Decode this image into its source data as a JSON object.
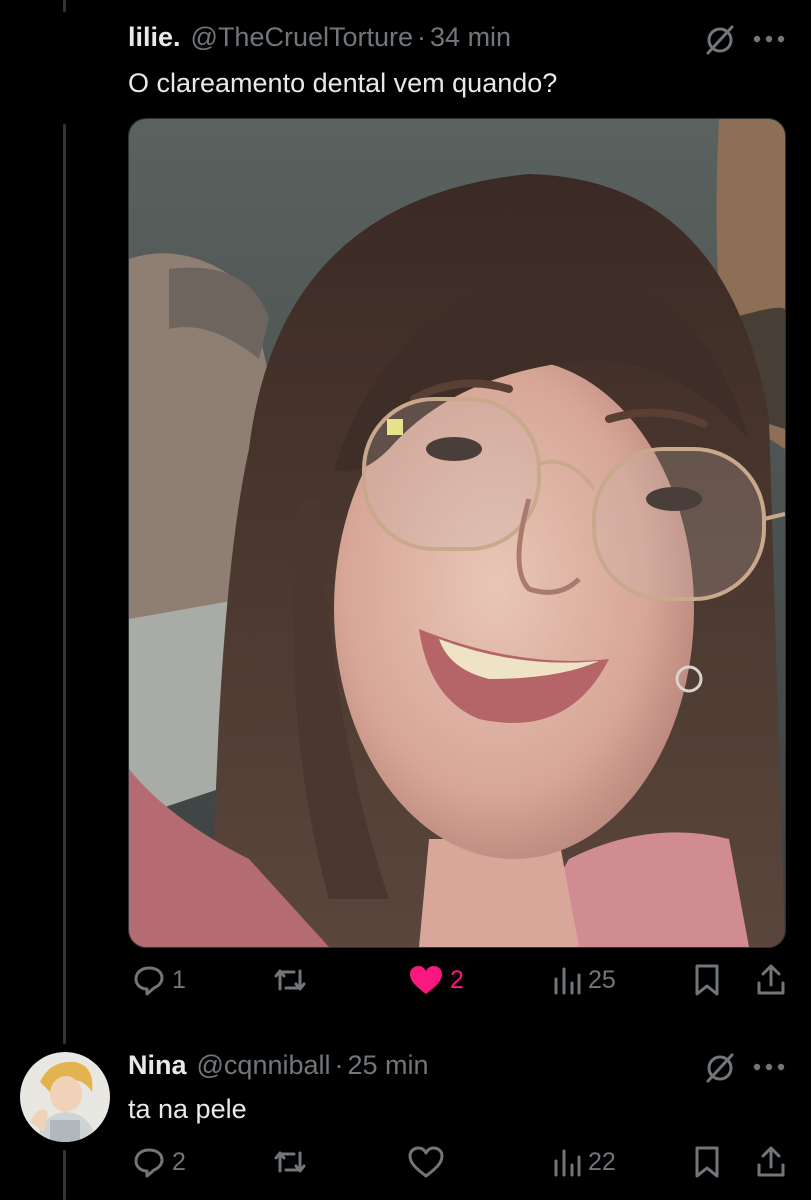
{
  "tweet1": {
    "display_name": "lilie.",
    "handle": "@TheCruelTorture",
    "separator": "·",
    "time": "34 min",
    "text": "O clareamento dental vem quando?",
    "media_icon": "selfie-photo",
    "actions": {
      "reply_count": "1",
      "retweet_count": "",
      "like_count": "2",
      "liked": true,
      "views_count": "25"
    }
  },
  "tweet2": {
    "display_name": "Nina",
    "handle": "@cqnniball",
    "separator": "·",
    "time": "25 min",
    "text": "ta na pele",
    "actions": {
      "reply_count": "2",
      "retweet_count": "",
      "like_count": "",
      "liked": false,
      "views_count": "22"
    }
  },
  "colors": {
    "background": "#000000",
    "text_primary": "#e7e9ea",
    "text_secondary": "#71767b",
    "like_active": "#f91880",
    "thread_line": "#333639"
  }
}
